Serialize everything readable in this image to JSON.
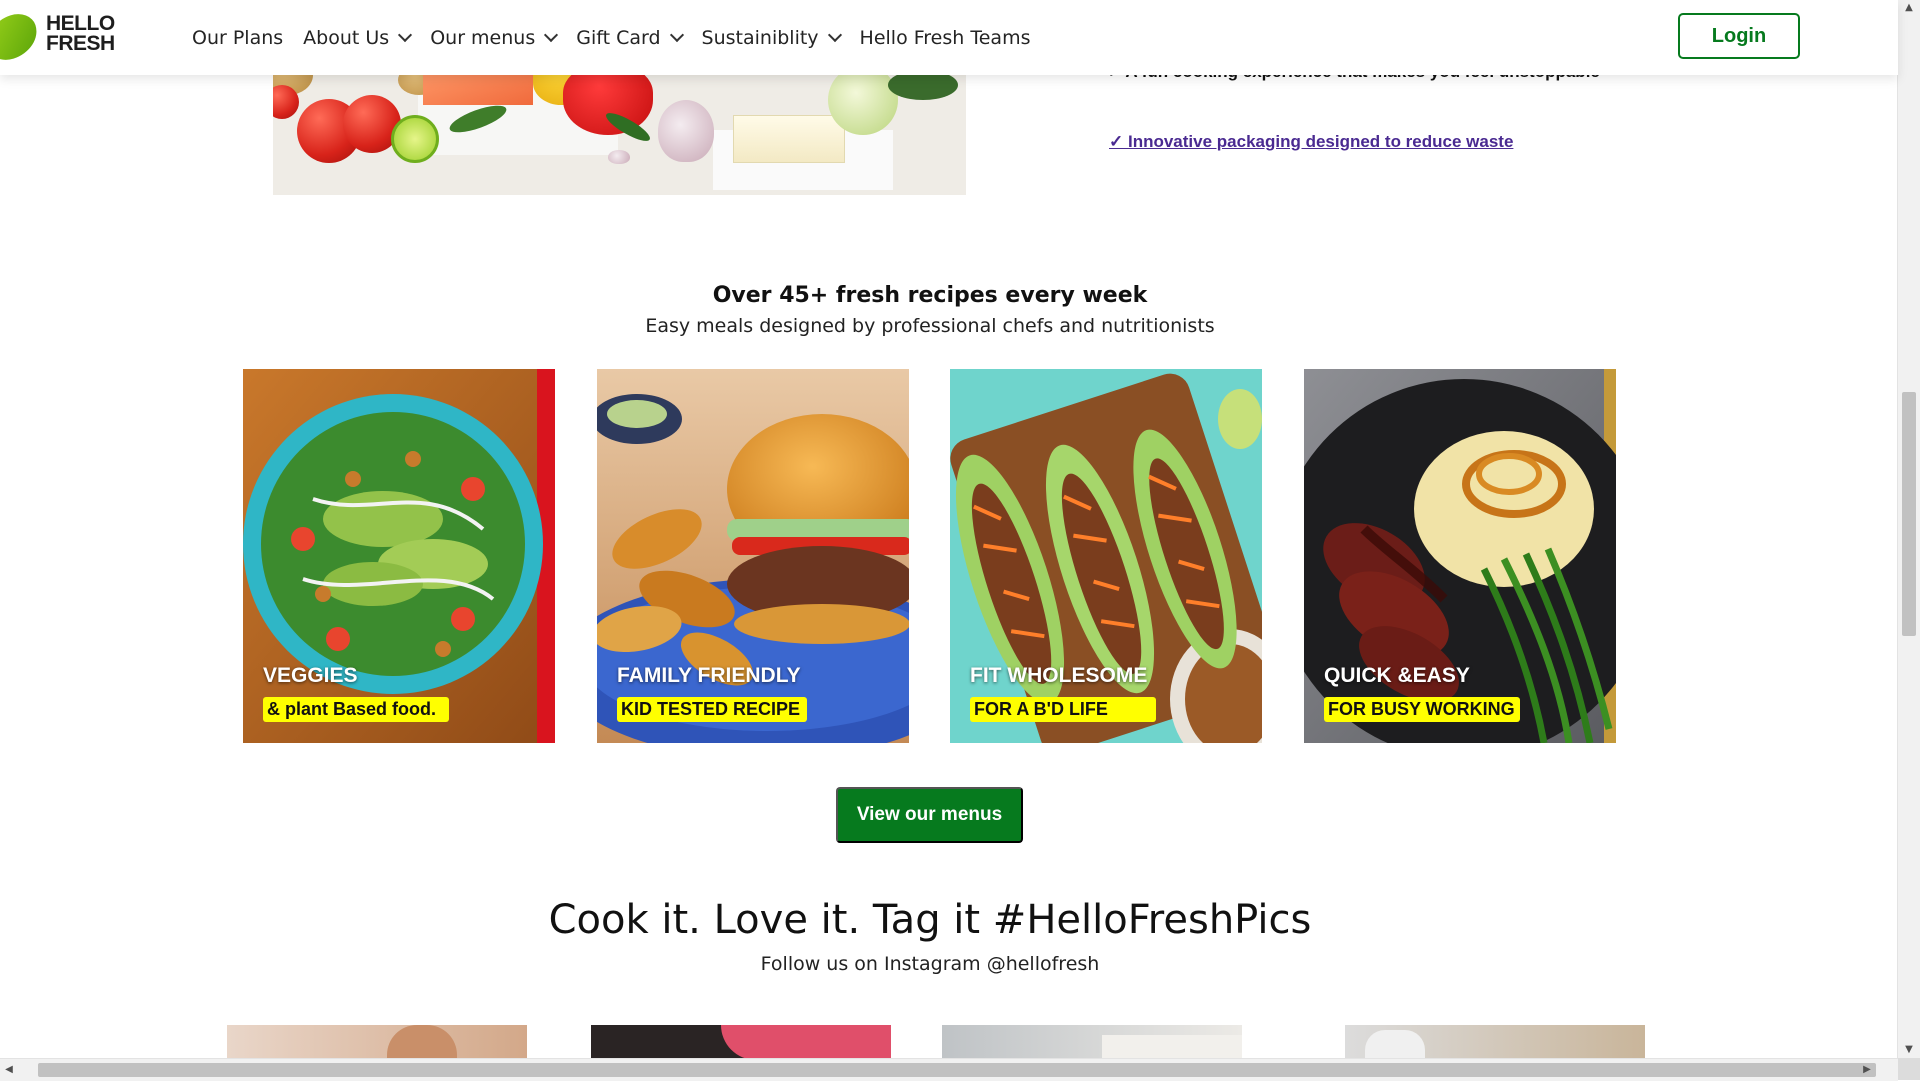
{
  "header": {
    "logo_line1": "HELLO",
    "logo_line2": "FRESH",
    "nav": [
      {
        "label": "Our Plans",
        "dropdown": false
      },
      {
        "label": "About Us",
        "dropdown": true
      },
      {
        "label": "Our menus",
        "dropdown": true
      },
      {
        "label": "Gift Card",
        "dropdown": true
      },
      {
        "label": "Sustainiblity",
        "dropdown": true
      },
      {
        "label": "Hello Fresh Teams",
        "dropdown": false
      }
    ],
    "login_label": "Login"
  },
  "hero": {
    "bullet_partial": "✓ A fun cooking experience that makes you feel unstoppable",
    "link_bullet": "✓ Innovative packaging designed to reduce waste"
  },
  "recipes": {
    "title": "Over 45+ fresh recipes every week",
    "subtitle": "Easy meals designed by professional chefs and nutritionists",
    "cards": [
      {
        "category": "VEGGIES",
        "tagline": "& plant Based food."
      },
      {
        "category": "FAMILY FRIENDLY",
        "tagline": "KID TESTED RECIPE"
      },
      {
        "category": "FIT WHOLESOME",
        "tagline": "FOR A B'D LIFE"
      },
      {
        "category": "QUICK &EASY",
        "tagline": "FOR BUSY WORKING"
      }
    ],
    "cta_label": "View our menus"
  },
  "instagram": {
    "title": "Cook it. Love it. Tag it #HelloFreshPics",
    "subtitle": "Follow us on Instagram @hellofresh"
  },
  "colors": {
    "brand_green": "#067a1e",
    "logo_lime": "#91c714",
    "highlight_yellow": "#ffff00",
    "link_purple": "#4a2a91"
  },
  "icons": {
    "dropdown": "chevron-down-icon",
    "scroll_up": "arrow-up-icon",
    "scroll_down": "arrow-down-icon",
    "scroll_left": "arrow-left-icon",
    "scroll_right": "arrow-right-icon"
  }
}
